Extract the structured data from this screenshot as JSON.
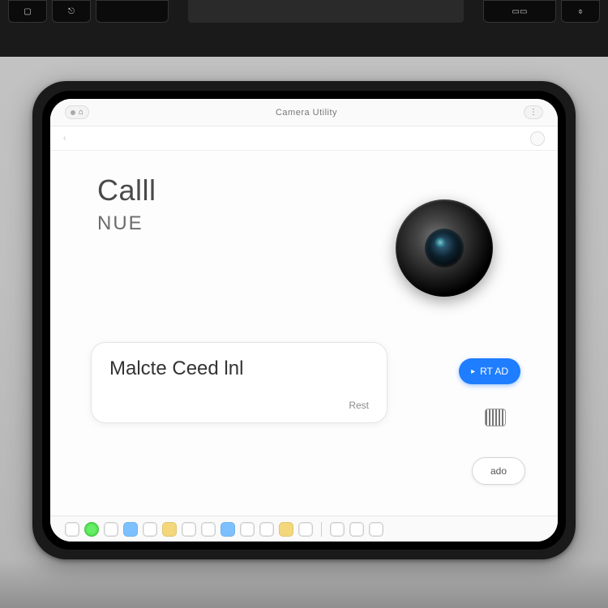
{
  "status": {
    "left_indicator": "⌂",
    "title": "Camera Utility",
    "right_indicator": "⋮"
  },
  "toolbar": {
    "breadcrumb": "‹",
    "action_icon": "○"
  },
  "main": {
    "heading": "Calll",
    "subheading": "NUE",
    "camera_name": "camera-lens"
  },
  "card": {
    "title": "Malcte Ceed lnl",
    "subtitle": "Rest"
  },
  "buttons": {
    "primary_label": "RT AD",
    "secondary_label": "ado"
  },
  "dock": {
    "items": [
      "system",
      "status",
      "finder",
      "safari",
      "mail",
      "notes",
      "music",
      "photos",
      "app1",
      "app2",
      "app3",
      "sep",
      "trash"
    ]
  }
}
